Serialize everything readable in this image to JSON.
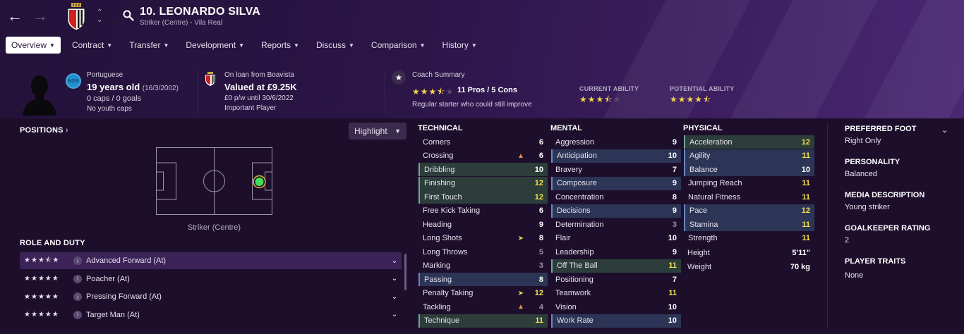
{
  "header": {
    "title": "10. LEONARDO SILVA",
    "subtitle": "Striker (Centre) - Vila Real"
  },
  "tabs": [
    {
      "label": "Overview",
      "active": true
    },
    {
      "label": "Contract"
    },
    {
      "label": "Transfer"
    },
    {
      "label": "Development"
    },
    {
      "label": "Reports"
    },
    {
      "label": "Discuss"
    },
    {
      "label": "Comparison"
    },
    {
      "label": "History"
    }
  ],
  "profile": {
    "nationality": "Portuguese",
    "nation_code": "NGN",
    "age": "19 years old",
    "dob": "(16/3/2002)",
    "caps": "0 caps / 0 goals",
    "youth_caps": "No youth caps"
  },
  "loan": {
    "on_loan": "On loan from Boavista",
    "value": "Valued at £9.25K",
    "wage": "£0 p/w until 30/6/2022",
    "status": "Important Player"
  },
  "coach": {
    "title": "Coach Summary",
    "stars": 3.5,
    "pros_cons": "11 Pros / 5 Cons",
    "summary": "Regular starter who could still improve"
  },
  "ability": {
    "current_label": "CURRENT ABILITY",
    "current_stars": 3.5,
    "potential_label": "POTENTIAL ABILITY",
    "potential_stars": 4.5
  },
  "positions": {
    "title": "POSITIONS",
    "highlight": "Highlight",
    "caption": "Striker (Centre)"
  },
  "roles": {
    "title": "ROLE AND DUTY",
    "items": [
      {
        "name": "Advanced Forward (At)",
        "stars": 3.5
      },
      {
        "name": "Poacher (At)",
        "stars": 3
      },
      {
        "name": "Pressing Forward (At)",
        "stars": 3
      },
      {
        "name": "Target Man (At)",
        "stars": 3
      }
    ]
  },
  "technical": {
    "title": "TECHNICAL",
    "rows": [
      {
        "name": "Corners",
        "value": "6",
        "tone": "w",
        "hl": ""
      },
      {
        "name": "Crossing",
        "value": "6",
        "tone": "w",
        "hl": "",
        "trend": "down"
      },
      {
        "name": "Dribbling",
        "value": "10",
        "tone": "w",
        "hl": "green"
      },
      {
        "name": "Finishing",
        "value": "12",
        "tone": "y",
        "hl": "green"
      },
      {
        "name": "First Touch",
        "value": "12",
        "tone": "y",
        "hl": "green"
      },
      {
        "name": "Free Kick Taking",
        "value": "6",
        "tone": "w",
        "hl": ""
      },
      {
        "name": "Heading",
        "value": "9",
        "tone": "w",
        "hl": ""
      },
      {
        "name": "Long Shots",
        "value": "8",
        "tone": "w",
        "hl": "",
        "trend": "up"
      },
      {
        "name": "Long Throws",
        "value": "5",
        "tone": "g",
        "hl": ""
      },
      {
        "name": "Marking",
        "value": "3",
        "tone": "g",
        "hl": ""
      },
      {
        "name": "Passing",
        "value": "8",
        "tone": "w",
        "hl": "blue"
      },
      {
        "name": "Penalty Taking",
        "value": "12",
        "tone": "y",
        "hl": "",
        "trend": "up"
      },
      {
        "name": "Tackling",
        "value": "4",
        "tone": "g",
        "hl": "",
        "trend": "down"
      },
      {
        "name": "Technique",
        "value": "11",
        "tone": "y",
        "hl": "green"
      }
    ]
  },
  "mental": {
    "title": "MENTAL",
    "rows": [
      {
        "name": "Aggression",
        "value": "9",
        "tone": "w",
        "hl": ""
      },
      {
        "name": "Anticipation",
        "value": "10",
        "tone": "w",
        "hl": "blue"
      },
      {
        "name": "Bravery",
        "value": "7",
        "tone": "w",
        "hl": ""
      },
      {
        "name": "Composure",
        "value": "9",
        "tone": "w",
        "hl": "blue"
      },
      {
        "name": "Concentration",
        "value": "8",
        "tone": "w",
        "hl": ""
      },
      {
        "name": "Decisions",
        "value": "9",
        "tone": "w",
        "hl": "blue"
      },
      {
        "name": "Determination",
        "value": "3",
        "tone": "g",
        "hl": ""
      },
      {
        "name": "Flair",
        "value": "10",
        "tone": "w",
        "hl": ""
      },
      {
        "name": "Leadership",
        "value": "9",
        "tone": "w",
        "hl": ""
      },
      {
        "name": "Off The Ball",
        "value": "11",
        "tone": "y",
        "hl": "green"
      },
      {
        "name": "Positioning",
        "value": "7",
        "tone": "w",
        "hl": ""
      },
      {
        "name": "Teamwork",
        "value": "11",
        "tone": "y",
        "hl": ""
      },
      {
        "name": "Vision",
        "value": "10",
        "tone": "w",
        "hl": ""
      },
      {
        "name": "Work Rate",
        "value": "10",
        "tone": "w",
        "hl": "blue"
      }
    ]
  },
  "physical": {
    "title": "PHYSICAL",
    "rows": [
      {
        "name": "Acceleration",
        "value": "12",
        "tone": "y",
        "hl": "green"
      },
      {
        "name": "Agility",
        "value": "11",
        "tone": "y",
        "hl": "blue"
      },
      {
        "name": "Balance",
        "value": "10",
        "tone": "w",
        "hl": "blue"
      },
      {
        "name": "Jumping Reach",
        "value": "11",
        "tone": "y",
        "hl": ""
      },
      {
        "name": "Natural Fitness",
        "value": "11",
        "tone": "y",
        "hl": ""
      },
      {
        "name": "Pace",
        "value": "12",
        "tone": "y",
        "hl": "blue"
      },
      {
        "name": "Stamina",
        "value": "11",
        "tone": "y",
        "hl": "blue"
      },
      {
        "name": "Strength",
        "value": "11",
        "tone": "y",
        "hl": ""
      }
    ],
    "height_label": "Height",
    "height": "5'11\"",
    "weight_label": "Weight",
    "weight": "70 kg"
  },
  "side": {
    "foot_title": "PREFERRED FOOT",
    "foot": "Right Only",
    "personality_title": "PERSONALITY",
    "personality": "Balanced",
    "media_title": "MEDIA DESCRIPTION",
    "media": "Young striker",
    "gk_title": "GOALKEEPER RATING",
    "gk": "2",
    "traits_title": "PLAYER TRAITS",
    "traits": "None"
  }
}
